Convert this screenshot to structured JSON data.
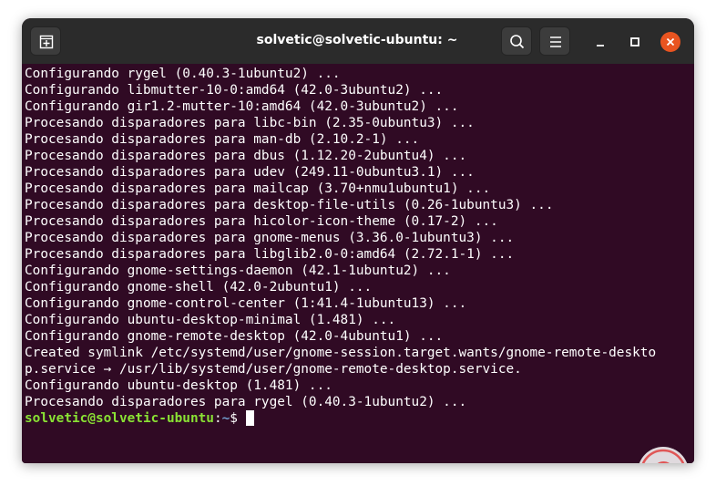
{
  "window": {
    "title": "solvetic@solvetic-ubuntu: ~"
  },
  "titlebar": {
    "new_tab_icon": "new-tab-icon",
    "search_icon": "search-icon",
    "menu_icon": "hamburger-menu-icon",
    "minimize_icon": "minimize-icon",
    "maximize_icon": "maximize-icon",
    "close_icon": "close-icon"
  },
  "terminal": {
    "lines": [
      "Configurando rygel (0.40.3-1ubuntu2) ...",
      "Configurando libmutter-10-0:amd64 (42.0-3ubuntu2) ...",
      "Configurando gir1.2-mutter-10:amd64 (42.0-3ubuntu2) ...",
      "Procesando disparadores para libc-bin (2.35-0ubuntu3) ...",
      "Procesando disparadores para man-db (2.10.2-1) ...",
      "Procesando disparadores para dbus (1.12.20-2ubuntu4) ...",
      "Procesando disparadores para udev (249.11-0ubuntu3.1) ...",
      "Procesando disparadores para mailcap (3.70+nmu1ubuntu1) ...",
      "Procesando disparadores para desktop-file-utils (0.26-1ubuntu3) ...",
      "Procesando disparadores para hicolor-icon-theme (0.17-2) ...",
      "Procesando disparadores para gnome-menus (3.36.0-1ubuntu3) ...",
      "Procesando disparadores para libglib2.0-0:amd64 (2.72.1-1) ...",
      "Configurando gnome-settings-daemon (42.1-1ubuntu2) ...",
      "Configurando gnome-shell (42.0-2ubuntu1) ...",
      "Configurando gnome-control-center (1:41.4-1ubuntu13) ...",
      "Configurando ubuntu-desktop-minimal (1.481) ...",
      "Configurando gnome-remote-desktop (42.0-4ubuntu1) ...",
      "Created symlink /etc/systemd/user/gnome-session.target.wants/gnome-remote-deskto",
      "p.service → /usr/lib/systemd/user/gnome-remote-desktop.service.",
      "Configurando ubuntu-desktop (1.481) ...",
      "Procesando disparadores para rygel (0.40.3-1ubuntu2) ..."
    ],
    "prompt_user": "solvetic@solvetic-ubuntu",
    "prompt_sep": ":",
    "prompt_path": "~",
    "prompt_symbol": "$ "
  },
  "colors": {
    "terminal_bg": "#300a24",
    "titlebar_bg": "#2b2b2b",
    "prompt_user": "#8ae234",
    "prompt_path": "#729fcf",
    "close_button": "#e95420"
  }
}
